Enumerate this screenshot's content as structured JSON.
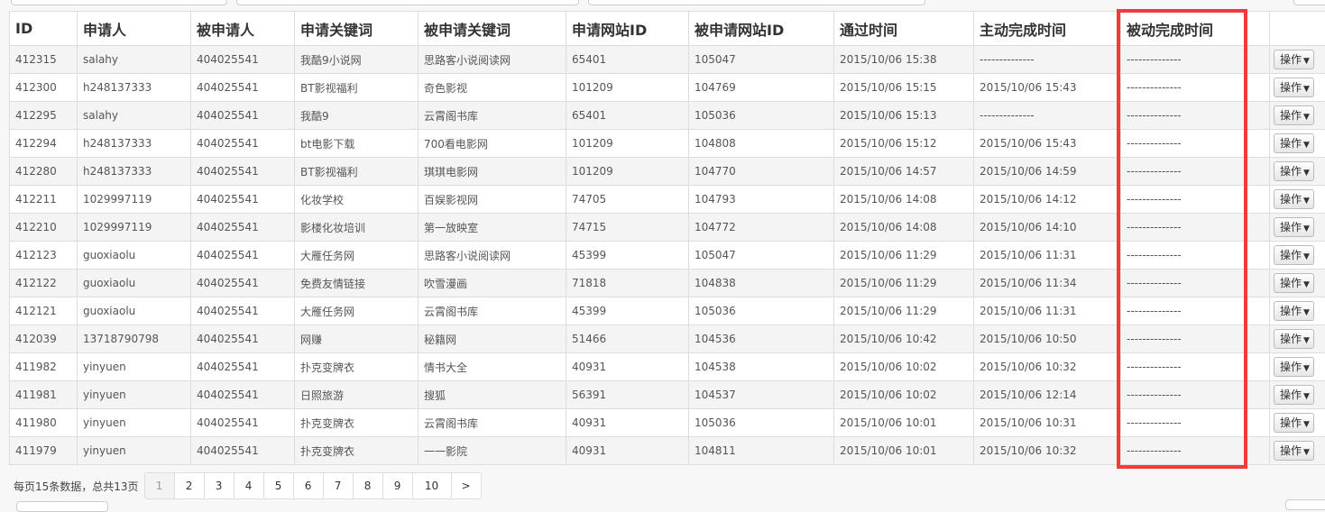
{
  "table": {
    "headers": [
      "ID",
      "申请人",
      "被申请人",
      "申请关键词",
      "被申请关键词",
      "申请网站ID",
      "被申请网站ID",
      "通过时间",
      "主动完成时间",
      "被动完成时间",
      ""
    ],
    "action_label": "操作",
    "rows": [
      [
        "412315",
        "salahy",
        "404025541",
        "我酷9小说网",
        "思路客小说阅读网",
        "65401",
        "105047",
        "2015/10/06 15:38",
        "--------------",
        "--------------"
      ],
      [
        "412300",
        "h248137333",
        "404025541",
        "BT影视福利",
        "奇色影视",
        "101209",
        "104769",
        "2015/10/06 15:15",
        "2015/10/06 15:43",
        "--------------"
      ],
      [
        "412295",
        "salahy",
        "404025541",
        "我酷9",
        "云霄阁书库",
        "65401",
        "105036",
        "2015/10/06 15:13",
        "--------------",
        "--------------"
      ],
      [
        "412294",
        "h248137333",
        "404025541",
        "bt电影下载",
        "700看电影网",
        "101209",
        "104808",
        "2015/10/06 15:12",
        "2015/10/06 15:43",
        "--------------"
      ],
      [
        "412280",
        "h248137333",
        "404025541",
        "BT影视福利",
        "琪琪电影网",
        "101209",
        "104770",
        "2015/10/06 14:57",
        "2015/10/06 14:59",
        "--------------"
      ],
      [
        "412211",
        "1029997119",
        "404025541",
        "化妆学校",
        "百娱影视网",
        "74705",
        "104793",
        "2015/10/06 14:08",
        "2015/10/06 14:12",
        "--------------"
      ],
      [
        "412210",
        "1029997119",
        "404025541",
        "影楼化妆培训",
        "第一放映室",
        "74715",
        "104772",
        "2015/10/06 14:08",
        "2015/10/06 14:10",
        "--------------"
      ],
      [
        "412123",
        "guoxiaolu",
        "404025541",
        "大雁任务网",
        "思路客小说阅读网",
        "45399",
        "105047",
        "2015/10/06 11:29",
        "2015/10/06 11:31",
        "--------------"
      ],
      [
        "412122",
        "guoxiaolu",
        "404025541",
        "免费友情链接",
        "吹雪漫画",
        "71818",
        "104838",
        "2015/10/06 11:29",
        "2015/10/06 11:34",
        "--------------"
      ],
      [
        "412121",
        "guoxiaolu",
        "404025541",
        "大雁任务网",
        "云霄阁书库",
        "45399",
        "105036",
        "2015/10/06 11:29",
        "2015/10/06 11:31",
        "--------------"
      ],
      [
        "412039",
        "13718790798",
        "404025541",
        "网赚",
        "秘籍网",
        "51466",
        "104536",
        "2015/10/06 10:42",
        "2015/10/06 10:50",
        "--------------"
      ],
      [
        "411982",
        "yinyuen",
        "404025541",
        "扑克变牌衣",
        "情书大全",
        "40931",
        "104538",
        "2015/10/06 10:02",
        "2015/10/06 10:32",
        "--------------"
      ],
      [
        "411981",
        "yinyuen",
        "404025541",
        "日照旅游",
        "搜狐",
        "56391",
        "104537",
        "2015/10/06 10:02",
        "2015/10/06 12:14",
        "--------------"
      ],
      [
        "411980",
        "yinyuen",
        "404025541",
        "扑克变牌衣",
        "云霄阁书库",
        "40931",
        "105036",
        "2015/10/06 10:01",
        "2015/10/06 10:31",
        "--------------"
      ],
      [
        "411979",
        "yinyuen",
        "404025541",
        "扑克变牌衣",
        "一一影院",
        "40931",
        "104811",
        "2015/10/06 10:01",
        "2015/10/06 10:32",
        "--------------"
      ]
    ]
  },
  "pagination": {
    "info": "每页15条数据，总共13页",
    "pages": [
      "1",
      "2",
      "3",
      "4",
      "5",
      "6",
      "7",
      "8",
      "9",
      "10",
      ">"
    ],
    "active_page": "1"
  },
  "colors": {
    "highlight": "#ef3b3b"
  }
}
